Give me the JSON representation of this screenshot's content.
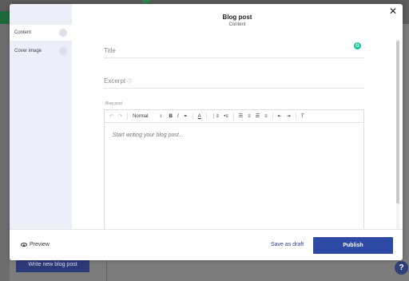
{
  "background": {
    "write_button_label": "Write new blog post",
    "help_label": "?"
  },
  "modal": {
    "title": "Blog post",
    "subtitle": "Content",
    "close_label": "✕",
    "sidebar": {
      "items": [
        {
          "label": "Content",
          "active": true
        },
        {
          "label": "Cover image",
          "active": false
        }
      ]
    },
    "fields": {
      "title_placeholder": "Title",
      "excerpt_placeholder": "Excerpt",
      "editor_label": "Blog post",
      "editor_placeholder": "Start writing your blog post..."
    },
    "toolbar": {
      "format_value": "Normal",
      "buttons": [
        "undo-icon",
        "redo-icon",
        "bold-icon",
        "italic-icon",
        "link-icon",
        "text-color-icon",
        "ordered-list-icon",
        "bullet-list-icon",
        "align-left-icon",
        "align-center-icon",
        "align-right-icon",
        "align-justify-icon",
        "outdent-icon",
        "indent-icon",
        "clear-format-icon"
      ]
    },
    "footer": {
      "preview_label": "Preview",
      "save_draft_label": "Save as draft",
      "publish_label": "Publish"
    },
    "colors": {
      "accent": "#2e4aa5",
      "grammarly": "#15c39a"
    }
  }
}
